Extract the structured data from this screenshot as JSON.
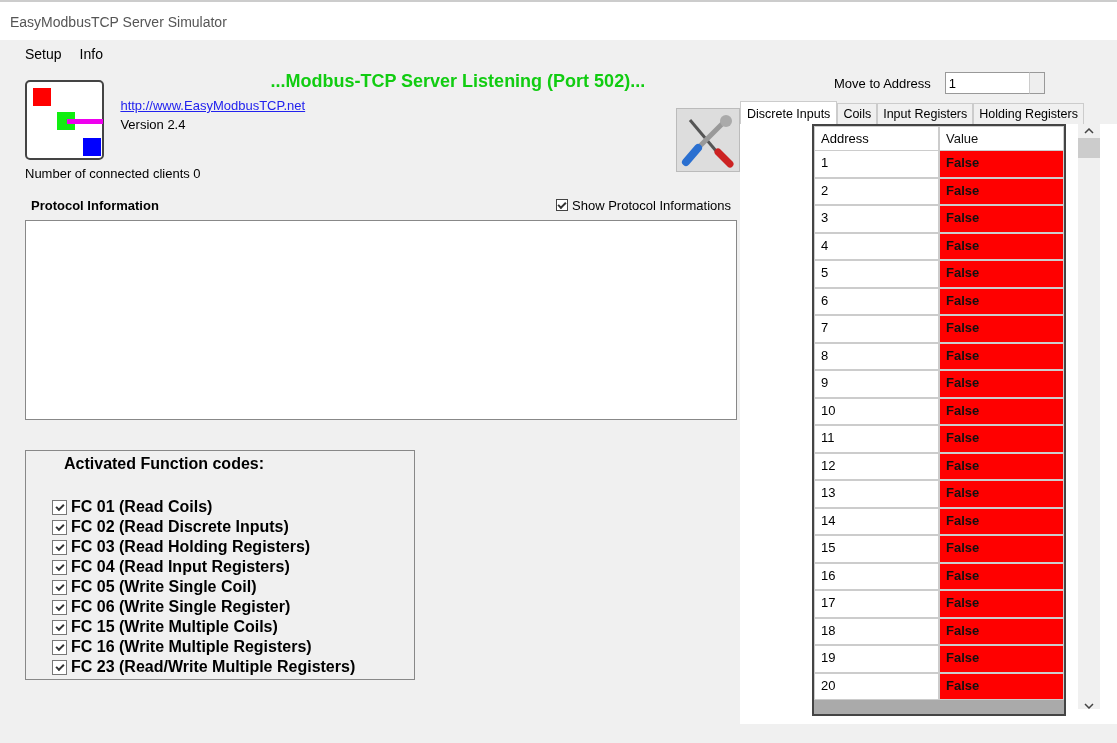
{
  "window": {
    "title": "EasyModbusTCP Server Simulator"
  },
  "menu": [
    "Setup",
    "Info"
  ],
  "status": "...Modbus-TCP Server Listening (Port 502)...",
  "link": "http://www.EasyModbusTCP.net",
  "version": "Version 2.4",
  "clients": "Number of connected clients 0",
  "protocol": {
    "title": "Protocol Information",
    "show_label": "Show Protocol Informations",
    "show_checked": true
  },
  "function_codes": {
    "title": "Activated Function codes:",
    "items": [
      {
        "label": "FC 01 (Read Coils)",
        "checked": true
      },
      {
        "label": "FC 02 (Read Discrete Inputs)",
        "checked": true
      },
      {
        "label": "FC 03 (Read Holding Registers)",
        "checked": true
      },
      {
        "label": "FC 04 (Read Input Registers)",
        "checked": true
      },
      {
        "label": "FC 05 (Write Single Coil)",
        "checked": true
      },
      {
        "label": "FC 06 (Write Single Register)",
        "checked": true
      },
      {
        "label": "FC 15 (Write Multiple Coils)",
        "checked": true
      },
      {
        "label": "FC 16 (Write Multiple Registers)",
        "checked": true
      },
      {
        "label": "FC 23 (Read/Write Multiple Registers)",
        "checked": true
      }
    ]
  },
  "move_to": {
    "label": "Move to Address",
    "value": "1"
  },
  "tabs": [
    {
      "label": "Discrete Inputs",
      "selected": true
    },
    {
      "label": "Coils",
      "selected": false
    },
    {
      "label": "Input Registers",
      "selected": false
    },
    {
      "label": "Holding Registers",
      "selected": false
    }
  ],
  "table": {
    "columns": [
      "Address",
      "Value"
    ],
    "rows": [
      [
        "1",
        "False"
      ],
      [
        "2",
        "False"
      ],
      [
        "3",
        "False"
      ],
      [
        "4",
        "False"
      ],
      [
        "5",
        "False"
      ],
      [
        "6",
        "False"
      ],
      [
        "7",
        "False"
      ],
      [
        "8",
        "False"
      ],
      [
        "9",
        "False"
      ],
      [
        "10",
        "False"
      ],
      [
        "11",
        "False"
      ],
      [
        "12",
        "False"
      ],
      [
        "13",
        "False"
      ],
      [
        "14",
        "False"
      ],
      [
        "15",
        "False"
      ],
      [
        "16",
        "False"
      ],
      [
        "17",
        "False"
      ],
      [
        "18",
        "False"
      ],
      [
        "19",
        "False"
      ],
      [
        "20",
        "False"
      ]
    ]
  }
}
